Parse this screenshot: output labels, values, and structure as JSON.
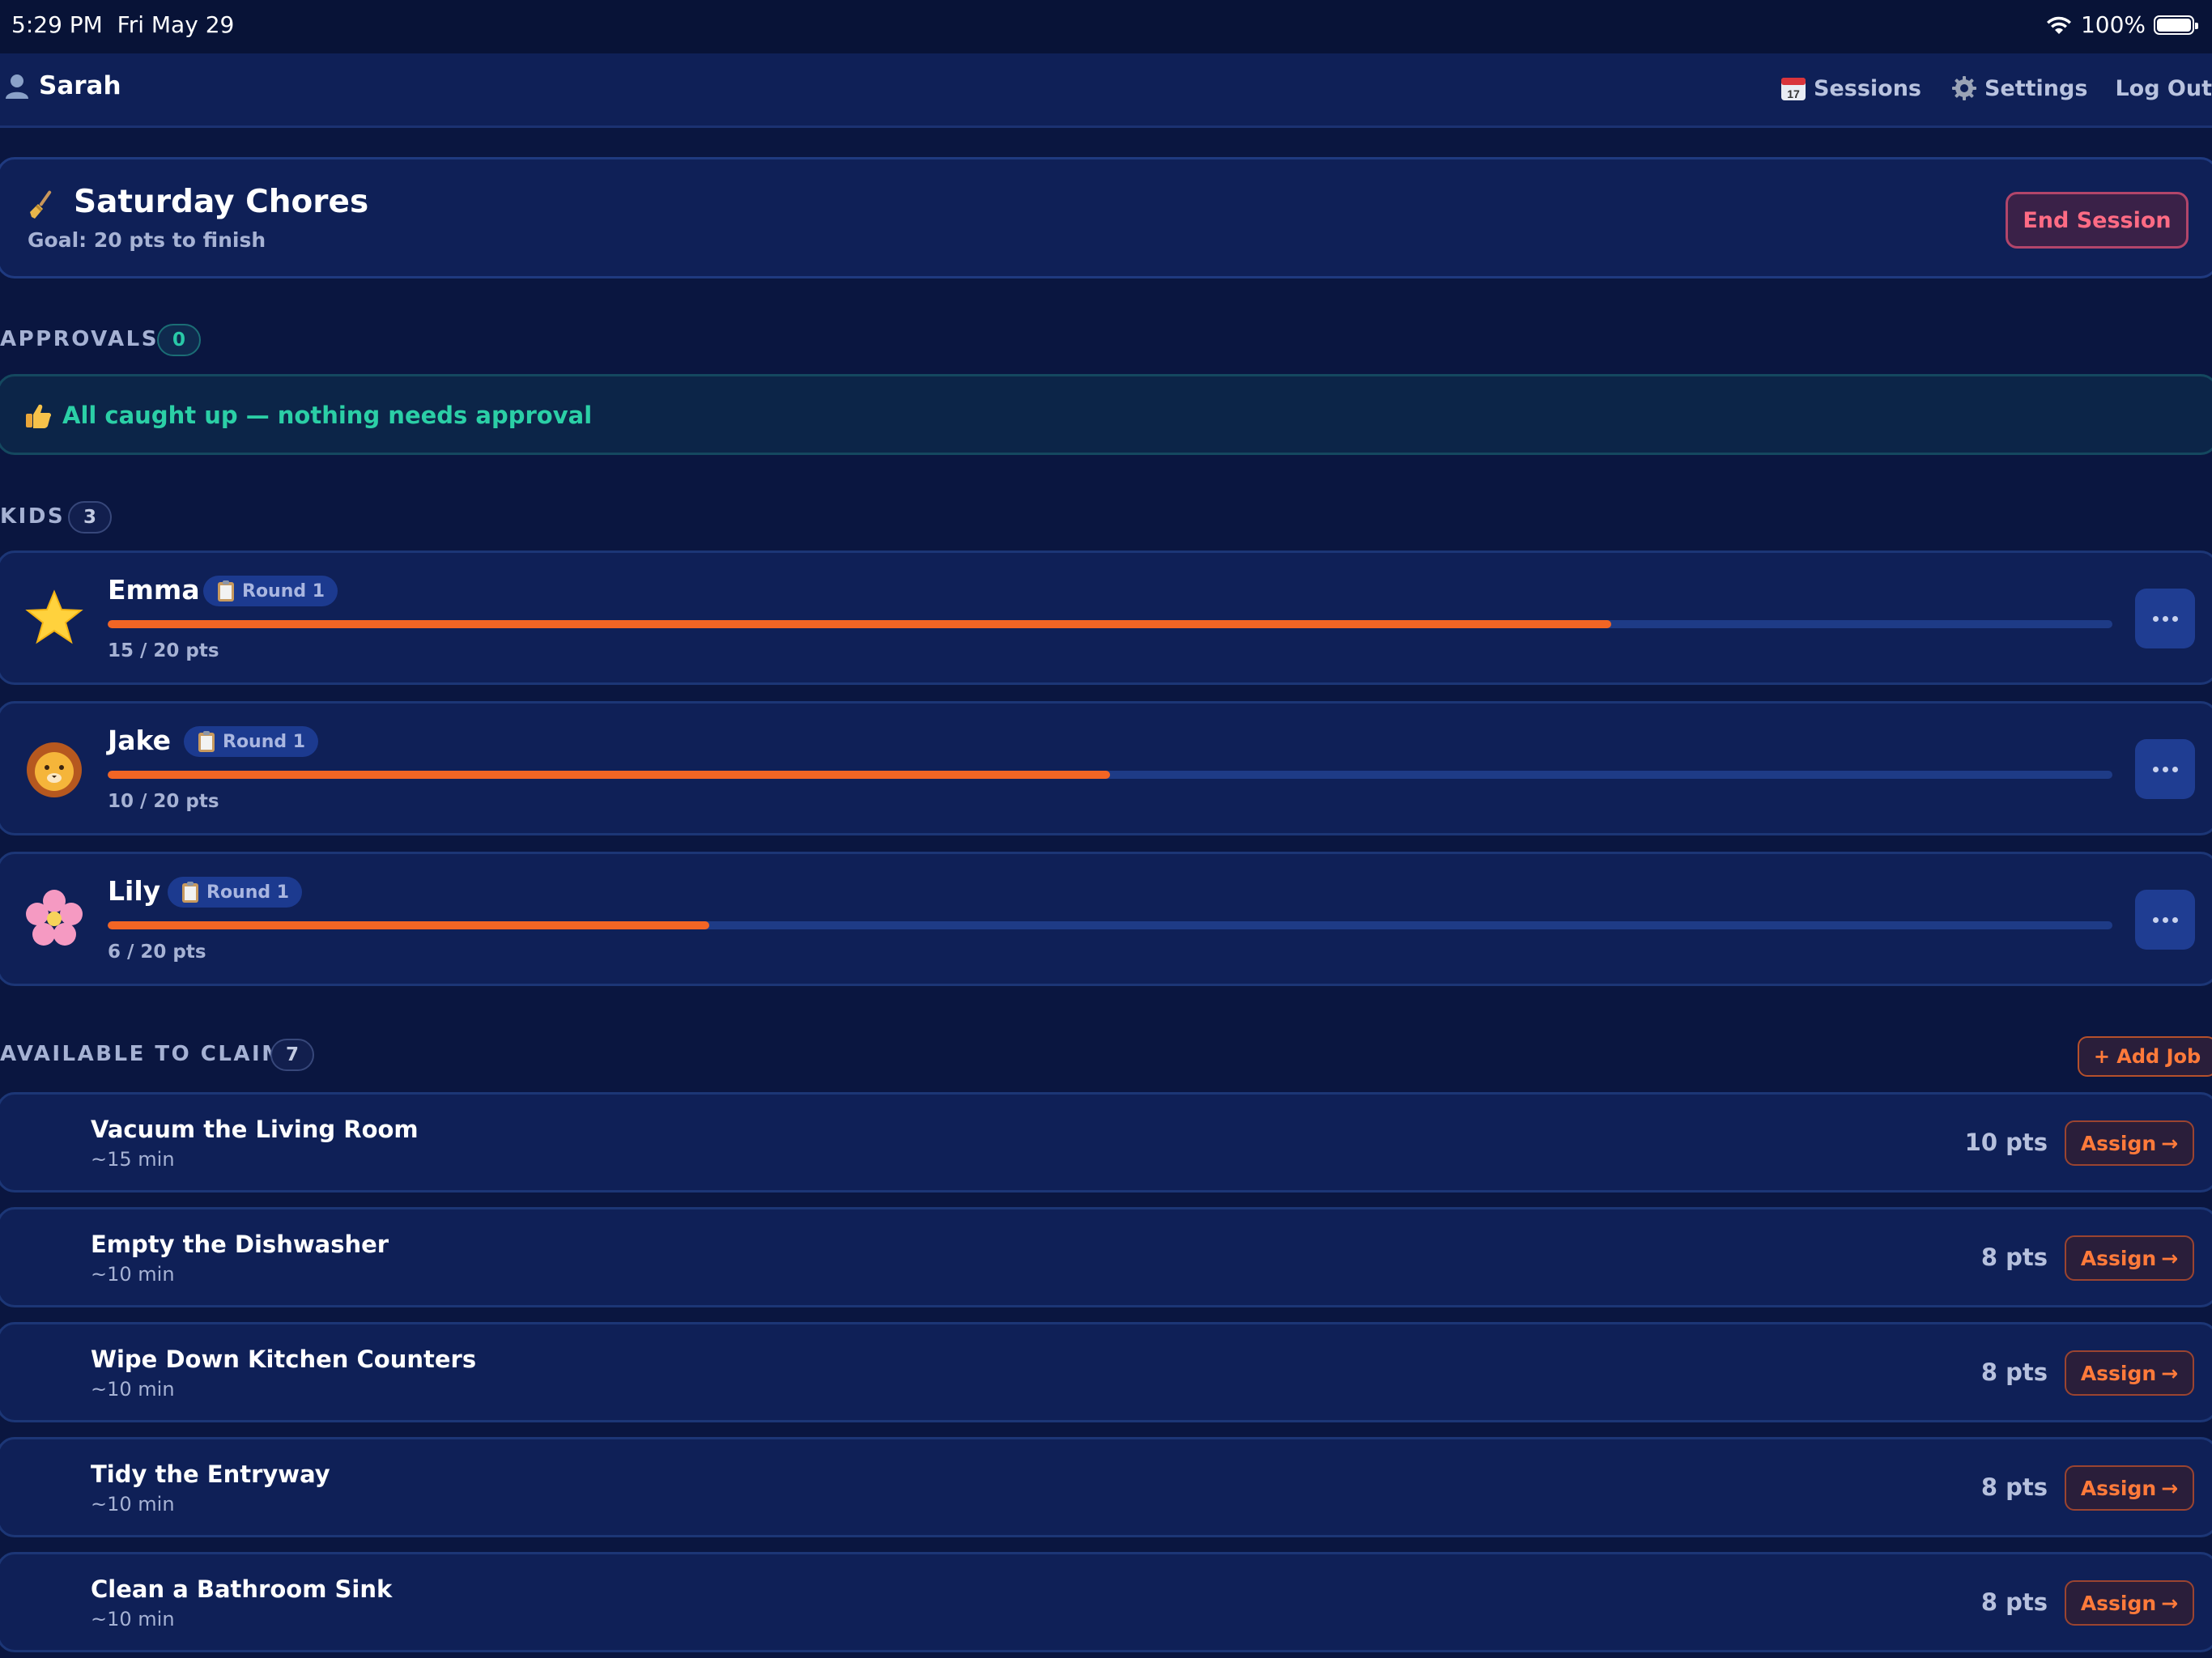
{
  "status_bar": {
    "time": "5:29 PM",
    "date": "Fri May 29",
    "battery": "100%"
  },
  "nav": {
    "user_name": "Sarah",
    "sessions_label": "Sessions",
    "settings_label": "Settings",
    "logout_label": "Log Out",
    "calendar_day": "17"
  },
  "session": {
    "title": "Saturday Chores",
    "goal": "Goal: 20 pts to finish",
    "end_label": "End Session"
  },
  "approvals": {
    "label": "APPROVALS",
    "count": "0",
    "message": "All caught up — nothing needs approval"
  },
  "kids_section": {
    "label": "KIDS",
    "count": "3"
  },
  "kids": [
    {
      "name": "Emma",
      "round": "Round 1",
      "points": "15 / 20 pts",
      "progress": 0.75,
      "avatar": "star-icon"
    },
    {
      "name": "Jake",
      "round": "Round 1",
      "points": "10 / 20 pts",
      "progress": 0.5,
      "avatar": "lion-icon"
    },
    {
      "name": "Lily",
      "round": "Round 1",
      "points": "6 / 20 pts",
      "progress": 0.3,
      "avatar": "flower-icon"
    }
  ],
  "jobs_section": {
    "label": "AVAILABLE TO CLAIM",
    "count": "7",
    "add_label": "+ Add Job"
  },
  "jobs": [
    {
      "title": "Vacuum the Living Room",
      "time": "~15 min",
      "points": "10 pts",
      "assign": "Assign"
    },
    {
      "title": "Empty the Dishwasher",
      "time": "~10 min",
      "points": "8 pts",
      "assign": "Assign"
    },
    {
      "title": "Wipe Down Kitchen Counters",
      "time": "~10 min",
      "points": "8 pts",
      "assign": "Assign"
    },
    {
      "title": "Tidy the Entryway",
      "time": "~10 min",
      "points": "8 pts",
      "assign": "Assign"
    },
    {
      "title": "Clean a Bathroom Sink",
      "time": "~10 min",
      "points": "8 pts",
      "assign": "Assign"
    }
  ],
  "colors": {
    "background": "#0a1640",
    "card": "#0f2057",
    "accent_orange": "#f26524",
    "teal": "#2bcfa6",
    "danger": "#ff6b84"
  }
}
